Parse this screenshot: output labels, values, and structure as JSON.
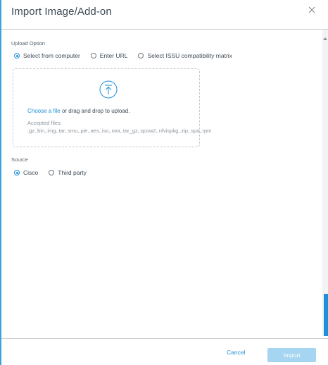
{
  "dialog": {
    "title": "Import Image/Add-on",
    "close_icon": "close-icon"
  },
  "upload_option": {
    "label": "Upload Option",
    "options": [
      {
        "label": "Select from computer",
        "selected": true
      },
      {
        "label": "Enter URL",
        "selected": false
      },
      {
        "label": "Select ISSU compatibility matrix",
        "selected": false
      }
    ]
  },
  "dropzone": {
    "icon": "upload-icon",
    "choose_link": "Choose a file",
    "drop_text": "or drag and drop to upload.",
    "accepted_files": "Accepted files: .gz,.bin,.img,.tar,.smu,.pie,.aes,.iso,.ova,.tar_gz,.qcow2,.nfvispkg,.zip,.spa,.rpm"
  },
  "source": {
    "label": "Source",
    "options": [
      {
        "label": "Cisco",
        "selected": true
      },
      {
        "label": "Third party",
        "selected": false
      }
    ]
  },
  "footer": {
    "cancel_label": "Cancel",
    "import_label": "Import"
  },
  "colors": {
    "accent": "#1e8fd8",
    "import_disabled": "#a5d5f0",
    "text": "#3d4a55",
    "muted": "#8a939b"
  }
}
